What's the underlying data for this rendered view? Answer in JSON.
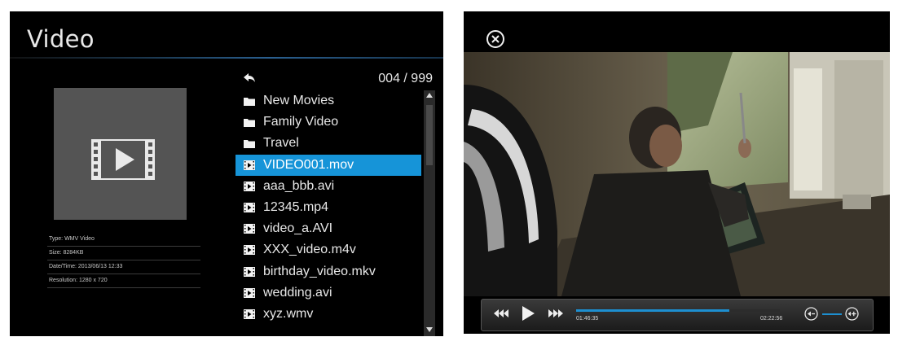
{
  "browser": {
    "title": "Video",
    "counter": "004 / 999",
    "details": {
      "type": "Type: WMV Video",
      "size": "Size: 8284KB",
      "datetime": "Date/Time: 2013/06/13 12:33",
      "resolution": "Resolution: 1280 x 720"
    },
    "items": [
      {
        "label": "New Movies",
        "icon": "folder-icon"
      },
      {
        "label": "Family Video",
        "icon": "folder-icon"
      },
      {
        "label": "Travel",
        "icon": "folder-icon"
      },
      {
        "label": "VIDEO001.mov",
        "icon": "video-file-icon",
        "selected": true
      },
      {
        "label": "aaa_bbb.avi",
        "icon": "video-file-icon"
      },
      {
        "label": "12345.mp4",
        "icon": "video-file-icon"
      },
      {
        "label": "video_a.AVI",
        "icon": "video-file-icon"
      },
      {
        "label": "XXX_video.m4v",
        "icon": "video-file-icon"
      },
      {
        "label": "birthday_video.mkv",
        "icon": "video-file-icon"
      },
      {
        "label": "wedding.avi",
        "icon": "video-file-icon"
      },
      {
        "label": "xyz.wmv",
        "icon": "video-file-icon"
      }
    ],
    "colors": {
      "selection": "#1694d8",
      "background": "#000000",
      "thumbnail": "#545454"
    }
  },
  "player": {
    "elapsed": "01:46:35",
    "total": "02:22:56",
    "progress": 0.75,
    "volume": 0.5,
    "colors": {
      "accent": "#1d8fd0"
    }
  }
}
